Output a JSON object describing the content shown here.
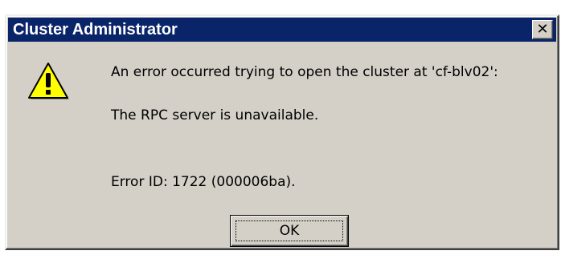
{
  "window": {
    "title": "Cluster Administrator",
    "close_glyph": "✕",
    "accent_color": "#0a246a",
    "background_color": "#d4d0c8"
  },
  "dialog": {
    "icon": "warning-icon",
    "message_line1": "An error occurred trying to open the cluster at 'cf-blv02':",
    "message_line2": "The RPC server is unavailable.",
    "error_id": "Error ID: 1722 (000006ba).",
    "ok_label": "OK"
  }
}
